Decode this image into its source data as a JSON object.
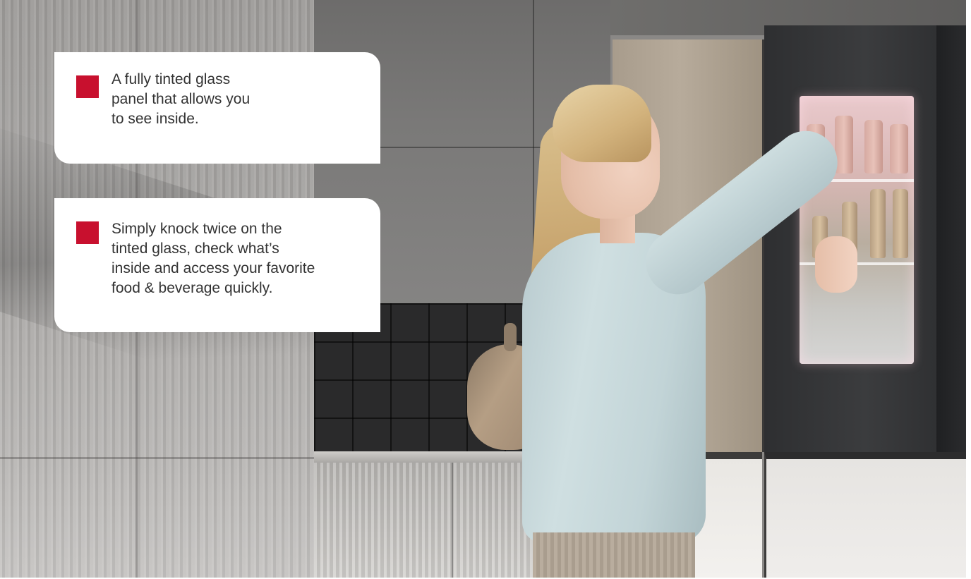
{
  "scene": {
    "image_description_icon": "kitchen-refrigerator-photo"
  },
  "callouts": [
    {
      "text": "A fully tinted glass\npanel that allows you\nto see inside."
    },
    {
      "text": "Simply knock twice on the\ntinted glass, check what’s\ninside and access your favorite\nfood & beverage quickly."
    }
  ],
  "colors": {
    "accent": "#c8102e",
    "card_background": "#ffffff",
    "text": "#333333"
  }
}
